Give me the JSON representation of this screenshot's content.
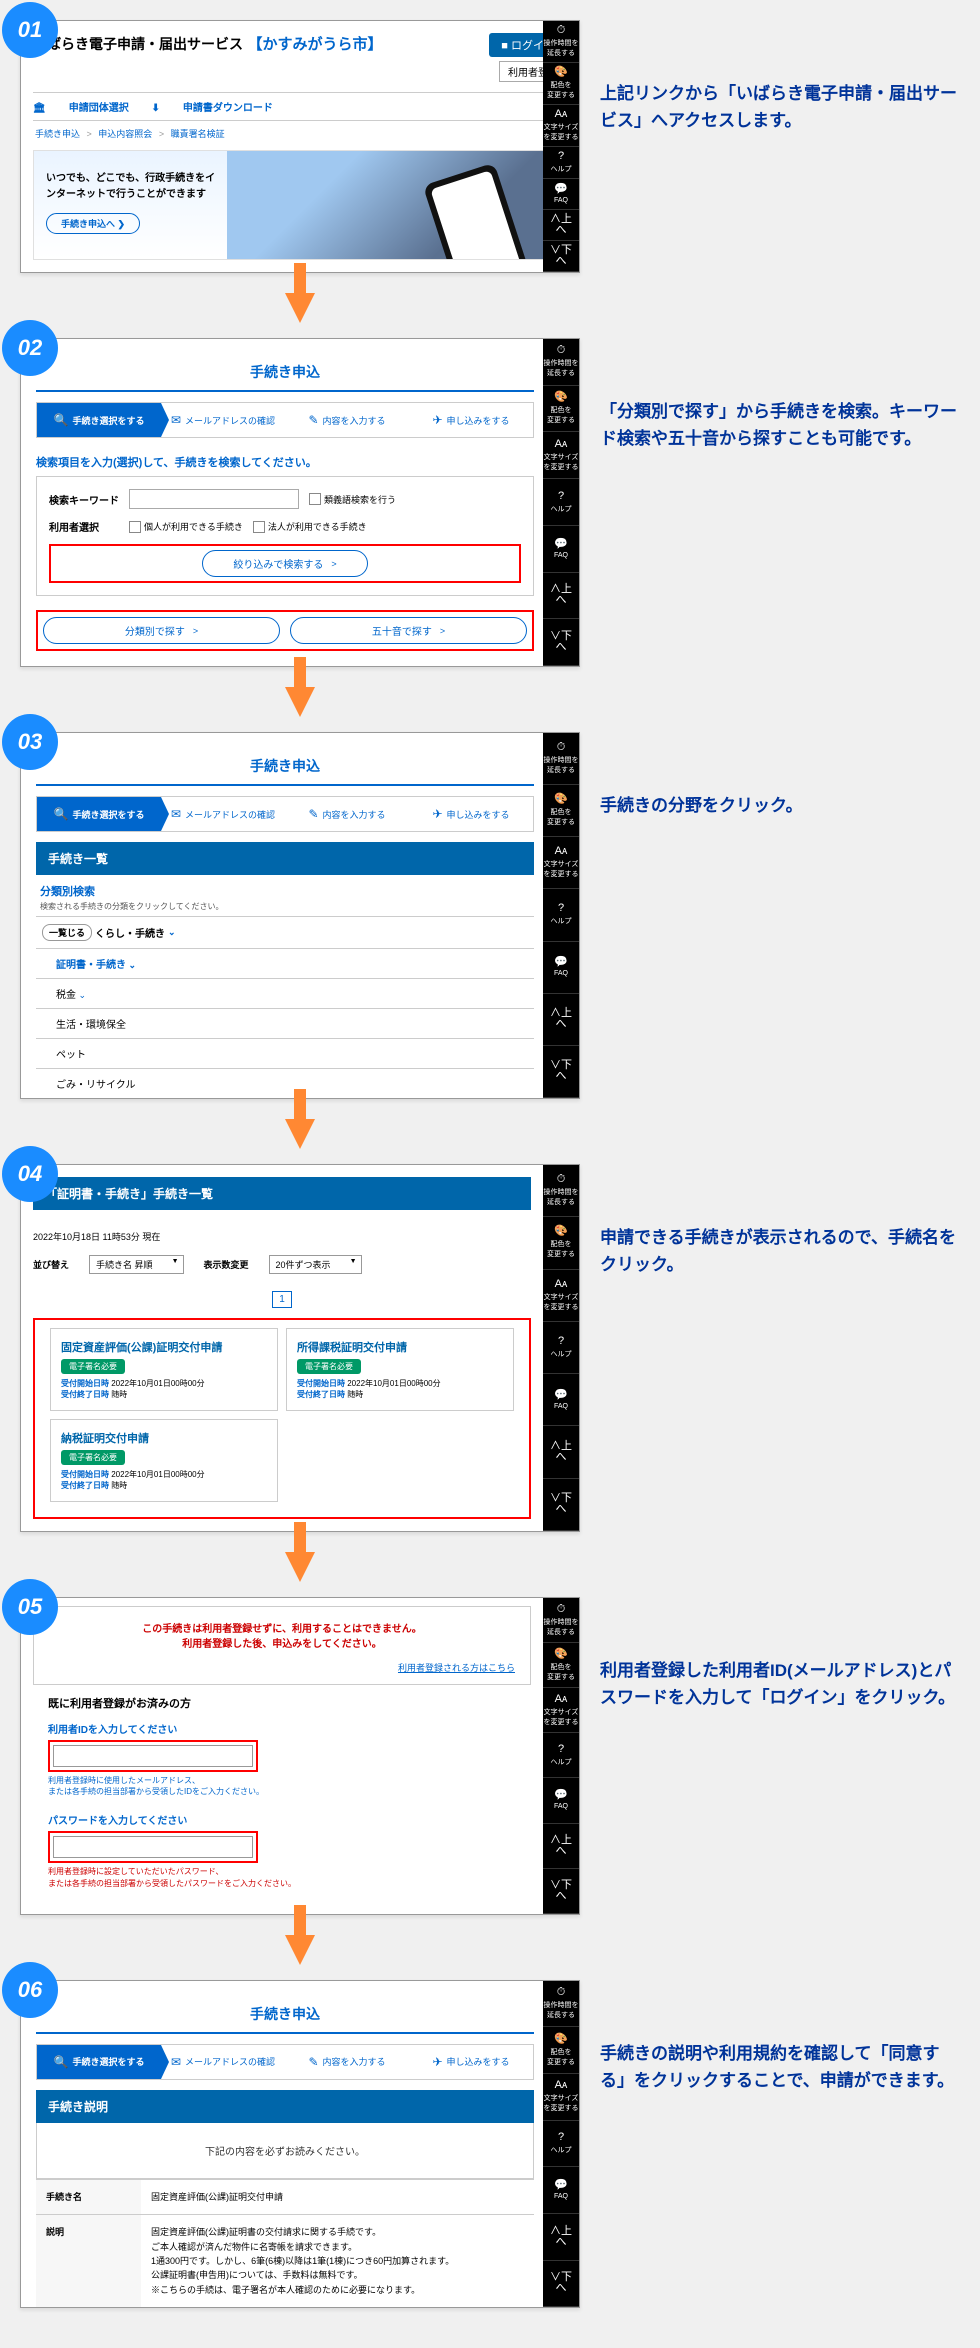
{
  "sideButtons": [
    {
      "icon": "⏱",
      "label": "操作時間を\n延長する",
      "name": "extend-time"
    },
    {
      "icon": "🎨",
      "label": "配色を\n変更する",
      "name": "change-color"
    },
    {
      "icon": "Aᴀ",
      "label": "文字サイズ\nを変更する",
      "name": "change-font"
    },
    {
      "icon": "?",
      "label": "ヘルプ",
      "name": "help"
    },
    {
      "icon": "💬",
      "label": "FAQ",
      "name": "faq"
    },
    {
      "icon": "∧上へ",
      "label": "",
      "name": "scroll-up"
    },
    {
      "icon": "∨下へ",
      "label": "",
      "name": "scroll-down"
    }
  ],
  "stepNav": {
    "s1": "手続き選択をする",
    "s2": "メールアドレスの確認",
    "s3": "内容を入力する",
    "s4": "申し込みをする",
    "i1": "🔍",
    "i2": "✉",
    "i3": "✎",
    "i4": "✈"
  },
  "step1": {
    "no": "01",
    "title_a": "いばらき電子申請・届出サービス",
    "title_b": "【かすみがうら市】",
    "login": "■ ログイン",
    "register": "利用者登録",
    "nav1": "申請団体選択",
    "nav2": "申請書ダウンロード",
    "bc1": "手続き申込",
    "bc2": "申込内容照会",
    "bc3": "職責署名検証",
    "hero_l1": "いつでも、どこでも、行政手続きをイ",
    "hero_l2": "ンターネットで行うことができます",
    "hero_btn": "手続き申込へ ❯",
    "desc": "上記リンクから「いばらき電子申請・届出サービス」へアクセスします。"
  },
  "step2": {
    "no": "02",
    "title": "手続き申込",
    "instruct": "検索項目を入力(選択)して、手続きを検索してください。",
    "kw_label": "検索キーワード",
    "sim_check": "類義語検索を行う",
    "usr_label": "利用者選択",
    "usr_opt1": "個人が利用できる手続き",
    "usr_opt2": "法人が利用できる手続き",
    "narrow": "絞り込みで検索する",
    "cat_btn": "分類別で探す",
    "gojuon_btn": "五十音で探す",
    "chev": ">",
    "desc": "「分類別で探す」から手続きを検索。キーワード検索や五十音から探すことも可能です。"
  },
  "step3": {
    "no": "03",
    "title": "手続き申込",
    "bar": "手続き一覧",
    "sub": "分類別検索",
    "note": "検索される手続きの分類をクリックしてください。",
    "accordion": "一覧じる",
    "top": "くらし・手続き",
    "cats": [
      "証明書・手続き",
      "税金",
      "生活・環境保全",
      "ペット",
      "ごみ・リサイクル"
    ],
    "desc": "手続きの分野をクリック。"
  },
  "step4": {
    "no": "04",
    "bar": "「証明書・手続き」手続き一覧",
    "meta": "2022年10月18日 11時53分 現在",
    "sort_label": "並び替え",
    "sort_val": "手続き名 昇順",
    "disp_label": "表示数変更",
    "disp_val": "20件ずつ表示",
    "page": "1",
    "tag": "電子署名必要",
    "cards": [
      {
        "t": "固定資産評価(公課)証明交付申請",
        "s": "2022年10月01日00時00分",
        "e": "随時"
      },
      {
        "t": "所得課税証明交付申請",
        "s": "2022年10月01日00時00分",
        "e": "随時"
      },
      {
        "t": "納税証明交付申請",
        "s": "2022年10月01日00時00分",
        "e": "随時"
      }
    ],
    "start_l": "受付開始日時",
    "end_l": "受付終了日時",
    "desc": "申請できる手続きが表示されるので、手続名をクリック。"
  },
  "step5": {
    "no": "05",
    "warn1": "この手続きは利用者登録せずに、利用することはできません。",
    "warn2": "利用者登録した後、申込みをしてください。",
    "link": "利用者登録される方はこちら",
    "h": "既に利用者登録がお済みの方",
    "id_label": "利用者IDを入力してください",
    "id_help1": "利用者登録時に使用したメールアドレス、",
    "id_help2": "または各手続の担当部署から受領したIDをご入力ください。",
    "pw_label": "パスワードを入力してください",
    "pw_help1": "利用者登録時に設定していただいたパスワード、",
    "pw_help2": "または各手続の担当部署から受領したパスワードをご入力ください。",
    "desc": "利用者登録した利用者ID(メールアドレス)とパスワードを入力して「ログイン」をクリック。"
  },
  "step6": {
    "no": "06",
    "title": "手続き申込",
    "bar": "手続き説明",
    "instruct": "下記の内容を必ずお読みください。",
    "row1_l": "手続き名",
    "row1_r": "固定資産評価(公課)証明交付申請",
    "row2_l": "説明",
    "row2_r1": "固定資産評価(公課)証明書の交付請求に関する手続です。",
    "row2_r2": "ご本人確認が済んだ物件に名寄帳を請求できます。",
    "row2_r3": "1通300円です。しかし、6筆(6棟)以降は1筆(1棟)につき60円加算されます。",
    "row2_r4": "公課証明書(申告用)については、手数料は無料です。",
    "row2_r5": "※こちらの手続は、電子署名が本人確認のために必要になります。",
    "desc": "手続きの説明や利用規約を確認して「同意する」をクリックすることで、申請ができます。"
  }
}
